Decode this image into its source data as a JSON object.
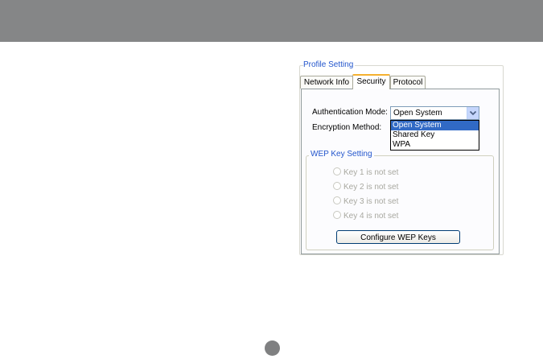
{
  "profile_setting": {
    "title": "Profile Setting",
    "tabs": [
      {
        "label": "Network Info"
      },
      {
        "label": "Security",
        "active": true
      },
      {
        "label": "Protocol"
      }
    ]
  },
  "security": {
    "auth_mode_label": "Authentication Mode:",
    "auth_mode_value": "Open System",
    "auth_mode_options": [
      "Open System",
      "Shared Key",
      "WPA"
    ],
    "encryption_label": "Encryption Method:",
    "wep_key_setting_title": "WEP Key Setting",
    "keys": [
      "Key 1 is not set",
      "Key 2 is not set",
      "Key 3 is not set",
      "Key 4 is not set"
    ],
    "configure_button": "Configure WEP Keys"
  },
  "icons": {
    "dropdown": "chevron-down-icon",
    "radio": "radio-icon"
  },
  "colors": {
    "header_band": "#858687",
    "group_title": "#2255cc",
    "selection": "#316ac5",
    "active_tab_accent": "#f5b030",
    "disabled_text": "#a8a8a0"
  }
}
